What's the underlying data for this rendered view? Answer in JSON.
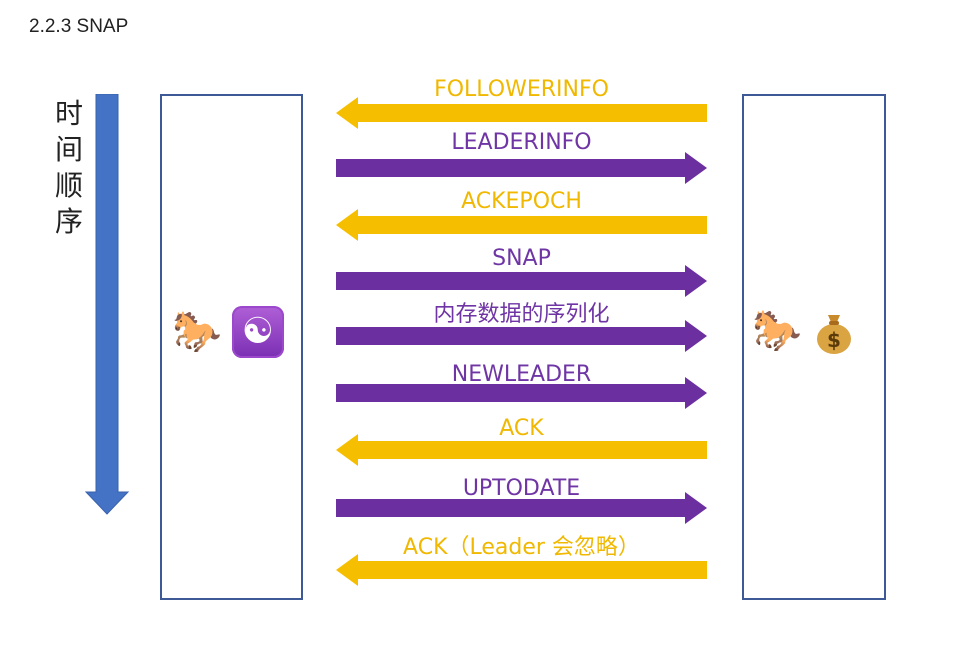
{
  "heading": "2.2.3 SNAP",
  "time_label": [
    "时",
    "间",
    "顺",
    "序"
  ],
  "colors": {
    "yellow": "#f5bf00",
    "purple": "#6b2fa0",
    "blue": "#4472c4",
    "box_border": "#3d5a96",
    "yellow_text": "#f0b800",
    "purple_text": "#6f35a5"
  },
  "left_icons": [
    "horse-icon",
    "yin-yang-icon"
  ],
  "right_icons": [
    "horse-icon",
    "money-bag-icon"
  ],
  "messages": [
    {
      "label": "FOLLOWERINFO",
      "direction": "left",
      "color": "yellow"
    },
    {
      "label": "LEADERINFO",
      "direction": "right",
      "color": "purple"
    },
    {
      "label": "ACKEPOCH",
      "direction": "left",
      "color": "yellow"
    },
    {
      "label": "SNAP",
      "direction": "right",
      "color": "purple"
    },
    {
      "label": "内存数据的序列化",
      "direction": "right",
      "color": "purple"
    },
    {
      "label": "NEWLEADER",
      "direction": "right",
      "color": "purple"
    },
    {
      "label": "ACK",
      "direction": "left",
      "color": "yellow"
    },
    {
      "label": "UPTODATE",
      "direction": "right",
      "color": "purple"
    },
    {
      "label": "ACK（Leader 会忽略）",
      "direction": "left",
      "color": "yellow"
    }
  ]
}
